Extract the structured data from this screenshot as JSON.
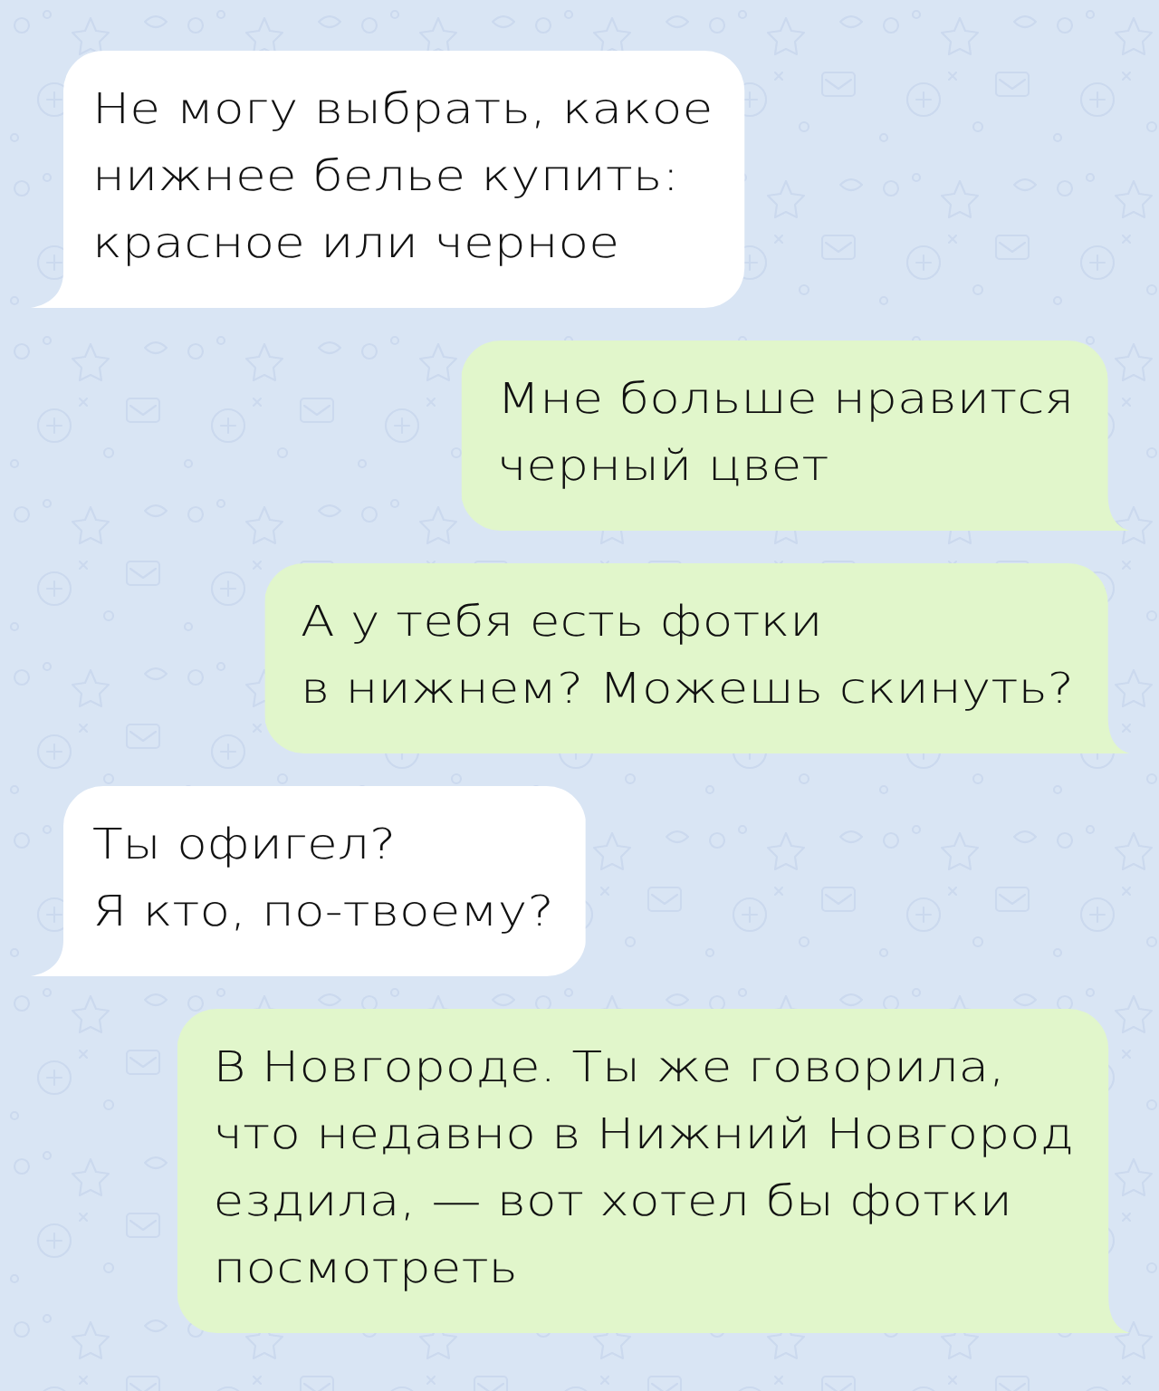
{
  "messages": [
    {
      "kind": "incoming",
      "text": "Не могу выбрать, какое\nнижнее белье купить:\nкрасное или черное"
    },
    {
      "kind": "outgoing",
      "text": "Мне больше нравится\nчерный цвет"
    },
    {
      "kind": "outgoing",
      "text": "А у тебя есть фотки\nв нижнем? Можешь скинуть?"
    },
    {
      "kind": "incoming",
      "text": "Ты офигел?\nЯ кто, по-твоему?"
    },
    {
      "kind": "outgoing",
      "text": "В Новгороде. Ты же говорила,\nчто недавно в Нижний Новгород\nездила, — вот хотел бы фотки\nпосмотреть"
    }
  ]
}
